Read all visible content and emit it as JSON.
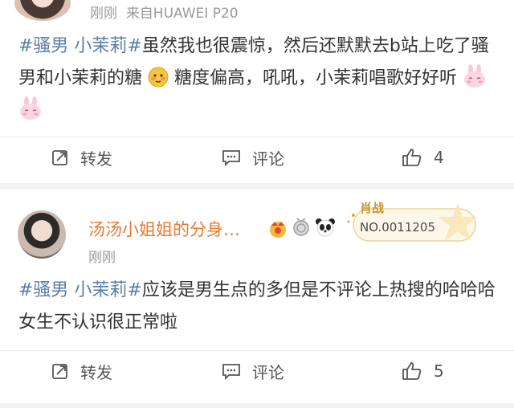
{
  "post1": {
    "time": "刚刚",
    "source": "来自HUAWEI P20",
    "topic": "#骚男 小茉莉#",
    "text_before_emoji": "虽然我也很震惊，然后还默默去b站上吃了骚男和小茉莉的糖",
    "text_after_emoji": "糖度偏高，吼吼，小茉莉唱歌好好听",
    "actions": {
      "repost": "转发",
      "comment": "评论",
      "like_count": "4"
    }
  },
  "post2": {
    "user_name": "汤汤小姐姐的分身…",
    "time": "刚刚",
    "badge_title": "肖战",
    "badge_number": "NO.0011205",
    "topic": "#骚男 小茉莉#",
    "text": "应该是男生点的多但是不评论上热搜的哈哈哈女生不认识很正常啦",
    "actions": {
      "repost": "转发",
      "comment": "评论",
      "like_count": "5"
    }
  },
  "colors": {
    "topic": "#5a7da8",
    "username": "#e87a2f",
    "meta": "#9a9a9a",
    "badge_gold": "#d4a83a"
  },
  "icons": [
    "repost-icon",
    "comment-icon",
    "like-icon",
    "crown-icon",
    "medal-icon",
    "panda-icon",
    "emoji-blush-icon",
    "bunny-icon",
    "star-icon"
  ]
}
